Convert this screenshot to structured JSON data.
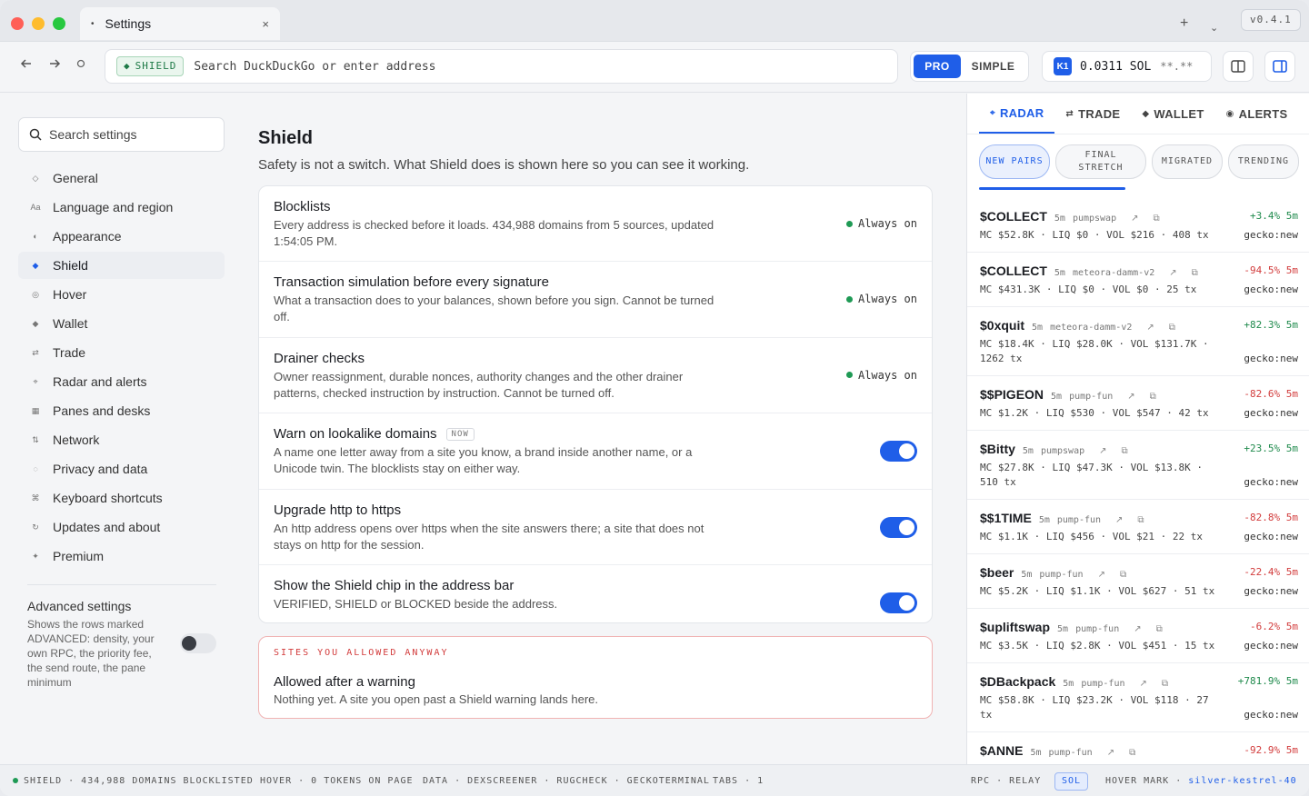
{
  "titlebar": {
    "tab_title": "Settings",
    "tab_dot": "•",
    "close_glyph": "×",
    "plus_glyph": "+",
    "chevron_glyph": "⌄",
    "version": "v0.4.1"
  },
  "toolbar": {
    "shield_chip": "SHIELD",
    "address_placeholder": "Search DuckDuckGo or enter address",
    "mode_pro": "PRO",
    "mode_simple": "SIMPLE",
    "wallet_badge": "K1",
    "sol_balance": "0.0311 SOL",
    "usd_balance": "**.**"
  },
  "sidebar": {
    "search_placeholder": "Search settings",
    "items": [
      {
        "icon": "◇",
        "label": "General",
        "active": false
      },
      {
        "icon": "Aa",
        "label": "Language and region",
        "active": false
      },
      {
        "icon": "◐",
        "label": "Appearance",
        "active": false
      },
      {
        "icon": "◆",
        "label": "Shield",
        "active": true
      },
      {
        "icon": "◎",
        "label": "Hover",
        "active": false
      },
      {
        "icon": "◆",
        "label": "Wallet",
        "active": false
      },
      {
        "icon": "⇄",
        "label": "Trade",
        "active": false
      },
      {
        "icon": "⌖",
        "label": "Radar and alerts",
        "active": false
      },
      {
        "icon": "▦",
        "label": "Panes and desks",
        "active": false
      },
      {
        "icon": "⇅",
        "label": "Network",
        "active": false
      },
      {
        "icon": "◌",
        "label": "Privacy and data",
        "active": false
      },
      {
        "icon": "⌘",
        "label": "Keyboard shortcuts",
        "active": false
      },
      {
        "icon": "↻",
        "label": "Updates and about",
        "active": false
      },
      {
        "icon": "✦",
        "label": "Premium",
        "active": false
      }
    ],
    "advanced": {
      "title": "Advanced settings",
      "description": "Shows the rows marked ADVANCED: density, your own RPC, the priority fee, the send route, the pane minimum",
      "enabled": false
    }
  },
  "main": {
    "title": "Shield",
    "subtitle": "Safety is not a switch. What Shield does is shown here so you can see it working.",
    "rows": [
      {
        "title": "Blocklists",
        "desc": "Every address is checked before it loads. 434,988 domains from 5 sources, updated 1:54:05 PM.",
        "state": "Always on"
      },
      {
        "title": "Transaction simulation before every signature",
        "desc": "What a transaction does to your balances, shown before you sign. Cannot be turned off.",
        "state": "Always on"
      },
      {
        "title": "Drainer checks",
        "desc": "Owner reassignment, durable nonces, authority changes and the other drainer patterns, checked instruction by instruction. Cannot be turned off.",
        "state": "Always on"
      },
      {
        "title": "Warn on lookalike domains",
        "badge": "NOW",
        "desc": "A name one letter away from a site you know, a brand inside another name, or a Unicode twin. The blocklists stay on either way.",
        "enabled": true
      },
      {
        "title": "Upgrade http to https",
        "desc": "An http address opens over https when the site answers there; a site that does not stays on http for the session.",
        "enabled": true
      },
      {
        "title": "Show the Shield chip in the address bar",
        "desc": "VERIFIED, SHIELD or BLOCKED beside the address.",
        "enabled": true
      }
    ],
    "allowed": {
      "heading": "SITES YOU ALLOWED ANYWAY",
      "title": "Allowed after a warning",
      "desc": "Nothing yet. A site you open past a Shield warning lands here."
    }
  },
  "panel": {
    "tabs": [
      {
        "icon": "⌖",
        "label": "RADAR",
        "active": true
      },
      {
        "icon": "⇄",
        "label": "TRADE",
        "active": false
      },
      {
        "icon": "◆",
        "label": "WALLET",
        "active": false
      },
      {
        "icon": "◉",
        "label": "ALERTS",
        "active": false
      }
    ],
    "filters": [
      {
        "label": "NEW PAIRS",
        "active": true
      },
      {
        "label": "FINAL STRETCH",
        "active": false
      },
      {
        "label": "MIGRATED",
        "active": false
      },
      {
        "label": "TRENDING",
        "active": false
      }
    ],
    "pairs": [
      {
        "symbol": "$COLLECT",
        "age": "5m",
        "dex": "pumpswap",
        "change": "+3.4% 5m",
        "dir": "up",
        "stats": "MC $52.8K · LIQ $0 · VOL $216 · 408 tx",
        "source": "gecko:new"
      },
      {
        "symbol": "$COLLECT",
        "age": "5m",
        "dex": "meteora-damm-v2",
        "change": "-94.5% 5m",
        "dir": "down",
        "stats": "MC $431.3K · LIQ $0 · VOL $0 · 25 tx",
        "source": "gecko:new"
      },
      {
        "symbol": "$0xquit",
        "age": "5m",
        "dex": "meteora-damm-v2",
        "change": "+82.3% 5m",
        "dir": "up",
        "stats": "MC $18.4K · LIQ $28.0K · VOL $131.7K · 1262 tx",
        "source": "gecko:new"
      },
      {
        "symbol": "$$PIGEON",
        "age": "5m",
        "dex": "pump-fun",
        "change": "-82.6% 5m",
        "dir": "down",
        "stats": "MC $1.2K · LIQ $530 · VOL $547 · 42 tx",
        "source": "gecko:new"
      },
      {
        "symbol": "$Bitty",
        "age": "5m",
        "dex": "pumpswap",
        "change": "+23.5% 5m",
        "dir": "up",
        "stats": "MC $27.8K · LIQ $47.3K · VOL $13.8K · 510 tx",
        "source": "gecko:new"
      },
      {
        "symbol": "$$1TIME",
        "age": "5m",
        "dex": "pump-fun",
        "change": "-82.8% 5m",
        "dir": "down",
        "stats": "MC $1.1K · LIQ $456 · VOL $21 · 22 tx",
        "source": "gecko:new"
      },
      {
        "symbol": "$beer",
        "age": "5m",
        "dex": "pump-fun",
        "change": "-22.4% 5m",
        "dir": "down",
        "stats": "MC $5.2K · LIQ $1.1K · VOL $627 · 51 tx",
        "source": "gecko:new"
      },
      {
        "symbol": "$upliftswap",
        "age": "5m",
        "dex": "pump-fun",
        "change": "-6.2% 5m",
        "dir": "down",
        "stats": "MC $3.5K · LIQ $2.8K · VOL $451 · 15 tx",
        "source": "gecko:new"
      },
      {
        "symbol": "$DBackpack",
        "age": "5m",
        "dex": "pump-fun",
        "change": "+781.9% 5m",
        "dir": "up",
        "stats": "MC $58.8K · LIQ $23.2K · VOL $118 · 27 tx",
        "source": "gecko:new"
      },
      {
        "symbol": "$ANNE",
        "age": "5m",
        "dex": "pump-fun",
        "change": "-92.9% 5m",
        "dir": "down",
        "stats": "",
        "source": ""
      }
    ]
  },
  "statusbar": {
    "shield": "SHIELD · 434,988 DOMAINS BLOCKLISTED",
    "hover": "HOVER · 0 TOKENS ON PAGE",
    "data": "DATA · DEXSCREENER · RUGCHECK · GECKOTERMINAL",
    "tabs": "TABS · 1",
    "rpc": "RPC · RELAY",
    "sol": "SOL",
    "hover_mark_label": "HOVER MARK ·",
    "hover_mark_value": "silver-kestrel-40"
  },
  "colors": {
    "accent": "#1f5ee8",
    "positive": "#1f8a4c",
    "negative": "#d23c3c",
    "warning_border": "#f0b3b3"
  }
}
